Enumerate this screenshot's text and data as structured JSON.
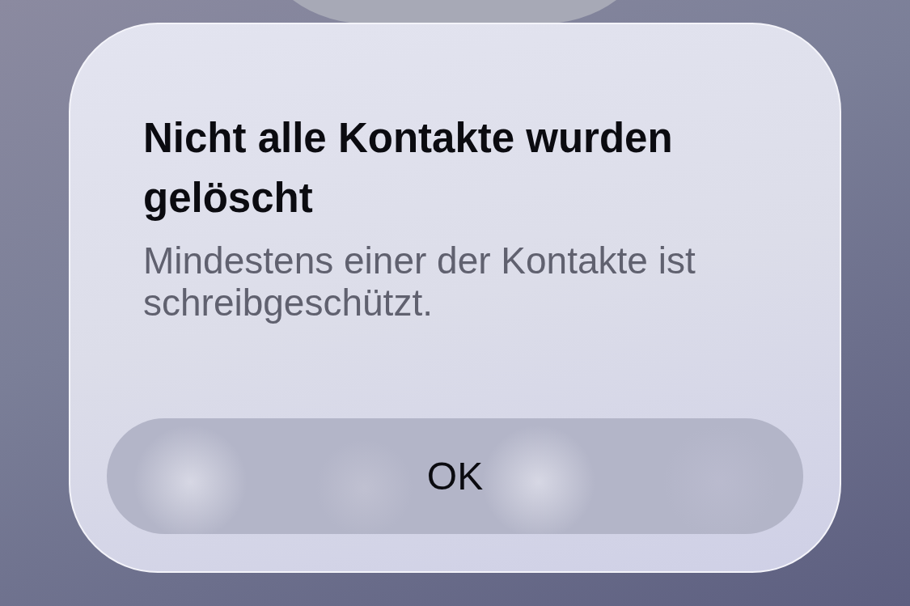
{
  "alert": {
    "title": "Nicht alle Kontakte wurden gelöscht",
    "message": "Mindestens einer der Kontakte ist schreibgeschützt.",
    "buttons": [
      {
        "label": "OK"
      }
    ]
  }
}
